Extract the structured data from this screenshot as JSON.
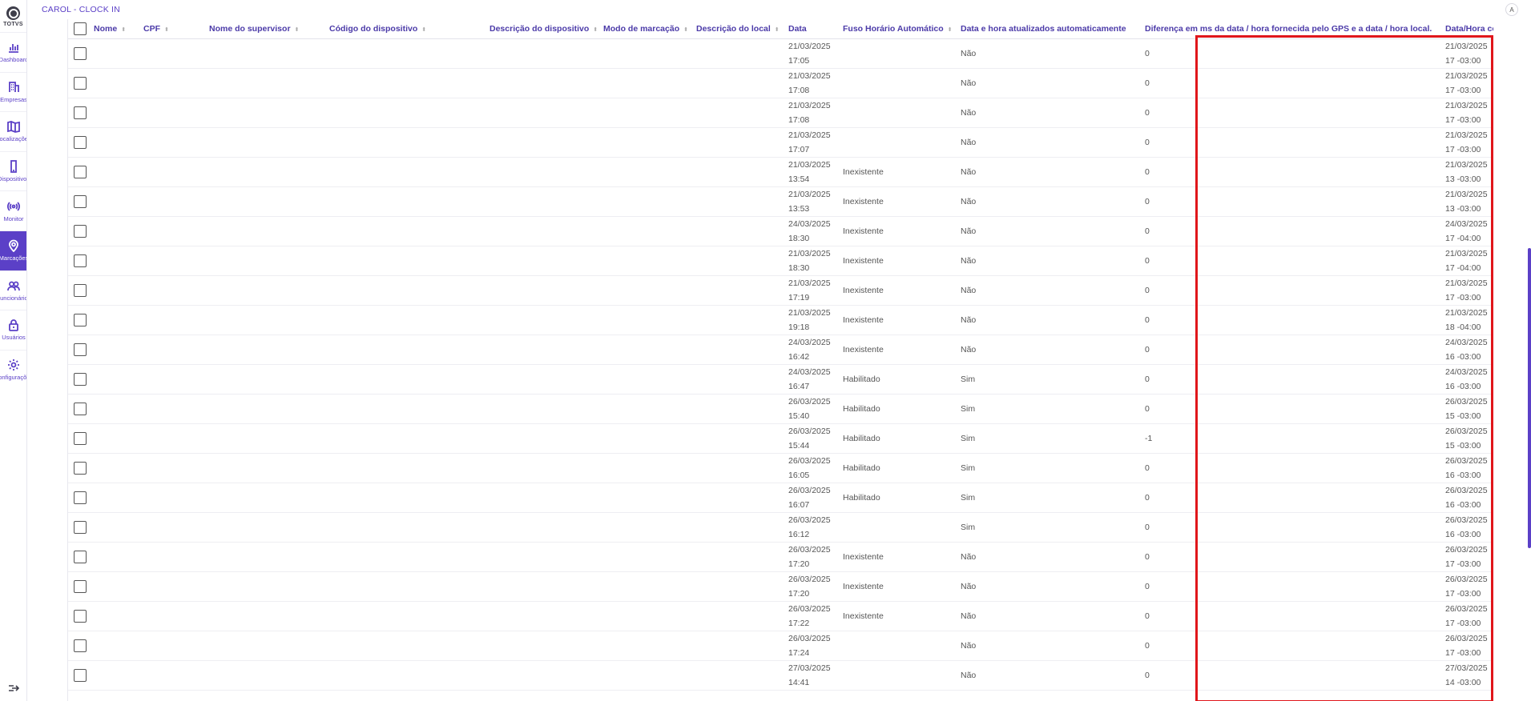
{
  "app": {
    "title": "CAROL - CLOCK IN",
    "user_icon": "A"
  },
  "sidebar": {
    "logo_text": "TOTVS",
    "items": [
      {
        "label": "Dashboard",
        "icon": "bar-chart-icon",
        "active": false
      },
      {
        "label": "Empresas",
        "icon": "building-icon",
        "active": false
      },
      {
        "label": "Localizações",
        "icon": "map-icon",
        "active": false
      },
      {
        "label": "Dispositivos",
        "icon": "phone-icon",
        "active": false
      },
      {
        "label": "Monitor",
        "icon": "broadcast-icon",
        "active": false
      },
      {
        "label": "Marcações",
        "icon": "map-pin-icon",
        "active": true
      },
      {
        "label": "Funcionários",
        "icon": "users-icon",
        "active": false
      },
      {
        "label": "Usuários",
        "icon": "lock-icon",
        "active": false
      },
      {
        "label": "Configurações",
        "icon": "gear-icon",
        "active": false
      }
    ]
  },
  "table": {
    "columns": [
      "Nome",
      "CPF",
      "Nome do supervisor",
      "Código do dispositivo",
      "Descrição do dispositivo",
      "Modo de marcação",
      "Descrição do local",
      "Data",
      "Fuso Horário Automático",
      "Data e hora atualizados automaticamente",
      "Diferença em ms da data / hora fornecida pelo GPS e a data / hora local.",
      "Data/Hora con"
    ],
    "rows": [
      {
        "data": "21/03/2025 17:05",
        "fuso": "",
        "auto": "Não",
        "diff": "0",
        "datahora": "21/03/2025 17 -03:00"
      },
      {
        "data": "21/03/2025 17:08",
        "fuso": "",
        "auto": "Não",
        "diff": "0",
        "datahora": "21/03/2025 17 -03:00"
      },
      {
        "data": "21/03/2025 17:08",
        "fuso": "",
        "auto": "Não",
        "diff": "0",
        "datahora": "21/03/2025 17 -03:00"
      },
      {
        "data": "21/03/2025 17:07",
        "fuso": "",
        "auto": "Não",
        "diff": "0",
        "datahora": "21/03/2025 17 -03:00"
      },
      {
        "data": "21/03/2025 13:54",
        "fuso": "Inexistente",
        "auto": "Não",
        "diff": "0",
        "datahora": "21/03/2025 13 -03:00"
      },
      {
        "data": "21/03/2025 13:53",
        "fuso": "Inexistente",
        "auto": "Não",
        "diff": "0",
        "datahora": "21/03/2025 13 -03:00"
      },
      {
        "data": "24/03/2025 18:30",
        "fuso": "Inexistente",
        "auto": "Não",
        "diff": "0",
        "datahora": "24/03/2025 17 -04:00"
      },
      {
        "data": "21/03/2025 18:30",
        "fuso": "Inexistente",
        "auto": "Não",
        "diff": "0",
        "datahora": "21/03/2025 17 -04:00"
      },
      {
        "data": "21/03/2025 17:19",
        "fuso": "Inexistente",
        "auto": "Não",
        "diff": "0",
        "datahora": "21/03/2025 17 -03:00"
      },
      {
        "data": "21/03/2025 19:18",
        "fuso": "Inexistente",
        "auto": "Não",
        "diff": "0",
        "datahora": "21/03/2025 18 -04:00"
      },
      {
        "data": "24/03/2025 16:42",
        "fuso": "Inexistente",
        "auto": "Não",
        "diff": "0",
        "datahora": "24/03/2025 16 -03:00"
      },
      {
        "data": "24/03/2025 16:47",
        "fuso": "Habilitado",
        "auto": "Sim",
        "diff": "0",
        "datahora": "24/03/2025 16 -03:00"
      },
      {
        "data": "26/03/2025 15:40",
        "fuso": "Habilitado",
        "auto": "Sim",
        "diff": "0",
        "datahora": "26/03/2025 15 -03:00"
      },
      {
        "data": "26/03/2025 15:44",
        "fuso": "Habilitado",
        "auto": "Sim",
        "diff": "-1",
        "datahora": "26/03/2025 15 -03:00"
      },
      {
        "data": "26/03/2025 16:05",
        "fuso": "Habilitado",
        "auto": "Sim",
        "diff": "0",
        "datahora": "26/03/2025 16 -03:00"
      },
      {
        "data": "26/03/2025 16:07",
        "fuso": "Habilitado",
        "auto": "Sim",
        "diff": "0",
        "datahora": "26/03/2025 16 -03:00"
      },
      {
        "data": "26/03/2025 16:12",
        "fuso": "",
        "auto": "Sim",
        "diff": "0",
        "datahora": "26/03/2025 16 -03:00"
      },
      {
        "data": "26/03/2025 17:20",
        "fuso": "Inexistente",
        "auto": "Não",
        "diff": "0",
        "datahora": "26/03/2025 17 -03:00"
      },
      {
        "data": "26/03/2025 17:20",
        "fuso": "Inexistente",
        "auto": "Não",
        "diff": "0",
        "datahora": "26/03/2025 17 -03:00"
      },
      {
        "data": "26/03/2025 17:22",
        "fuso": "Inexistente",
        "auto": "Não",
        "diff": "0",
        "datahora": "26/03/2025 17 -03:00"
      },
      {
        "data": "26/03/2025 17:24",
        "fuso": "",
        "auto": "Não",
        "diff": "0",
        "datahora": "26/03/2025 17 -03:00"
      },
      {
        "data": "27/03/2025 14:41",
        "fuso": "",
        "auto": "Não",
        "diff": "0",
        "datahora": "27/03/2025 14 -03:00"
      }
    ]
  },
  "colors": {
    "accent": "#5b40c7",
    "highlight": "#e0161b"
  }
}
